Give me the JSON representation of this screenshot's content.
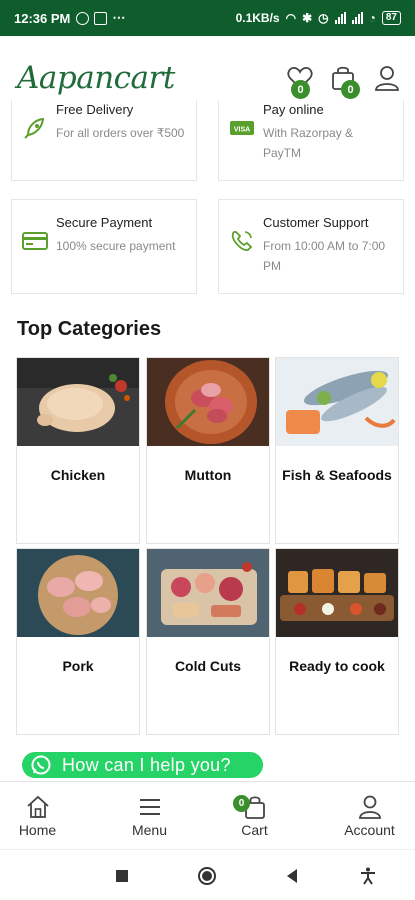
{
  "status_bar": {
    "time": "12:36 PM",
    "network_speed": "0.1KB/s",
    "battery": "87"
  },
  "header": {
    "logo": "Aapancart",
    "wishlist_count": "0",
    "cart_count": "0",
    "icons": [
      "heart-icon",
      "shopping-bag-icon",
      "user-icon"
    ]
  },
  "features": [
    {
      "title": "Free Delivery",
      "desc": "For all orders over ₹500",
      "icon": "rocket-icon"
    },
    {
      "title": "Pay online",
      "desc": "With Razorpay & PayTM",
      "icon": "visa-card-icon"
    },
    {
      "title": "Secure Payment",
      "desc": "100% secure payment",
      "icon": "credit-card-icon"
    },
    {
      "title": "Customer Support",
      "desc": "From 10:00 AM to 7:00 PM",
      "icon": "phone-icon"
    }
  ],
  "section_title": "Top Categories",
  "categories": [
    {
      "label": "Chicken"
    },
    {
      "label": "Mutton"
    },
    {
      "label": "Fish & Seafoods"
    },
    {
      "label": "Pork"
    },
    {
      "label": "Cold Cuts"
    },
    {
      "label": "Ready to cook"
    }
  ],
  "whatsapp": {
    "label": "How can I help you?"
  },
  "bottom_nav": {
    "home": "Home",
    "menu": "Menu",
    "cart": "Cart",
    "cart_count": "0",
    "account": "Account"
  },
  "colors": {
    "brand_green": "#1f6b3a",
    "status_bar": "#0f5d2c",
    "badge_green": "#3a8f2c",
    "whatsapp": "#25d366",
    "feature_icon": "#5aa02c"
  }
}
